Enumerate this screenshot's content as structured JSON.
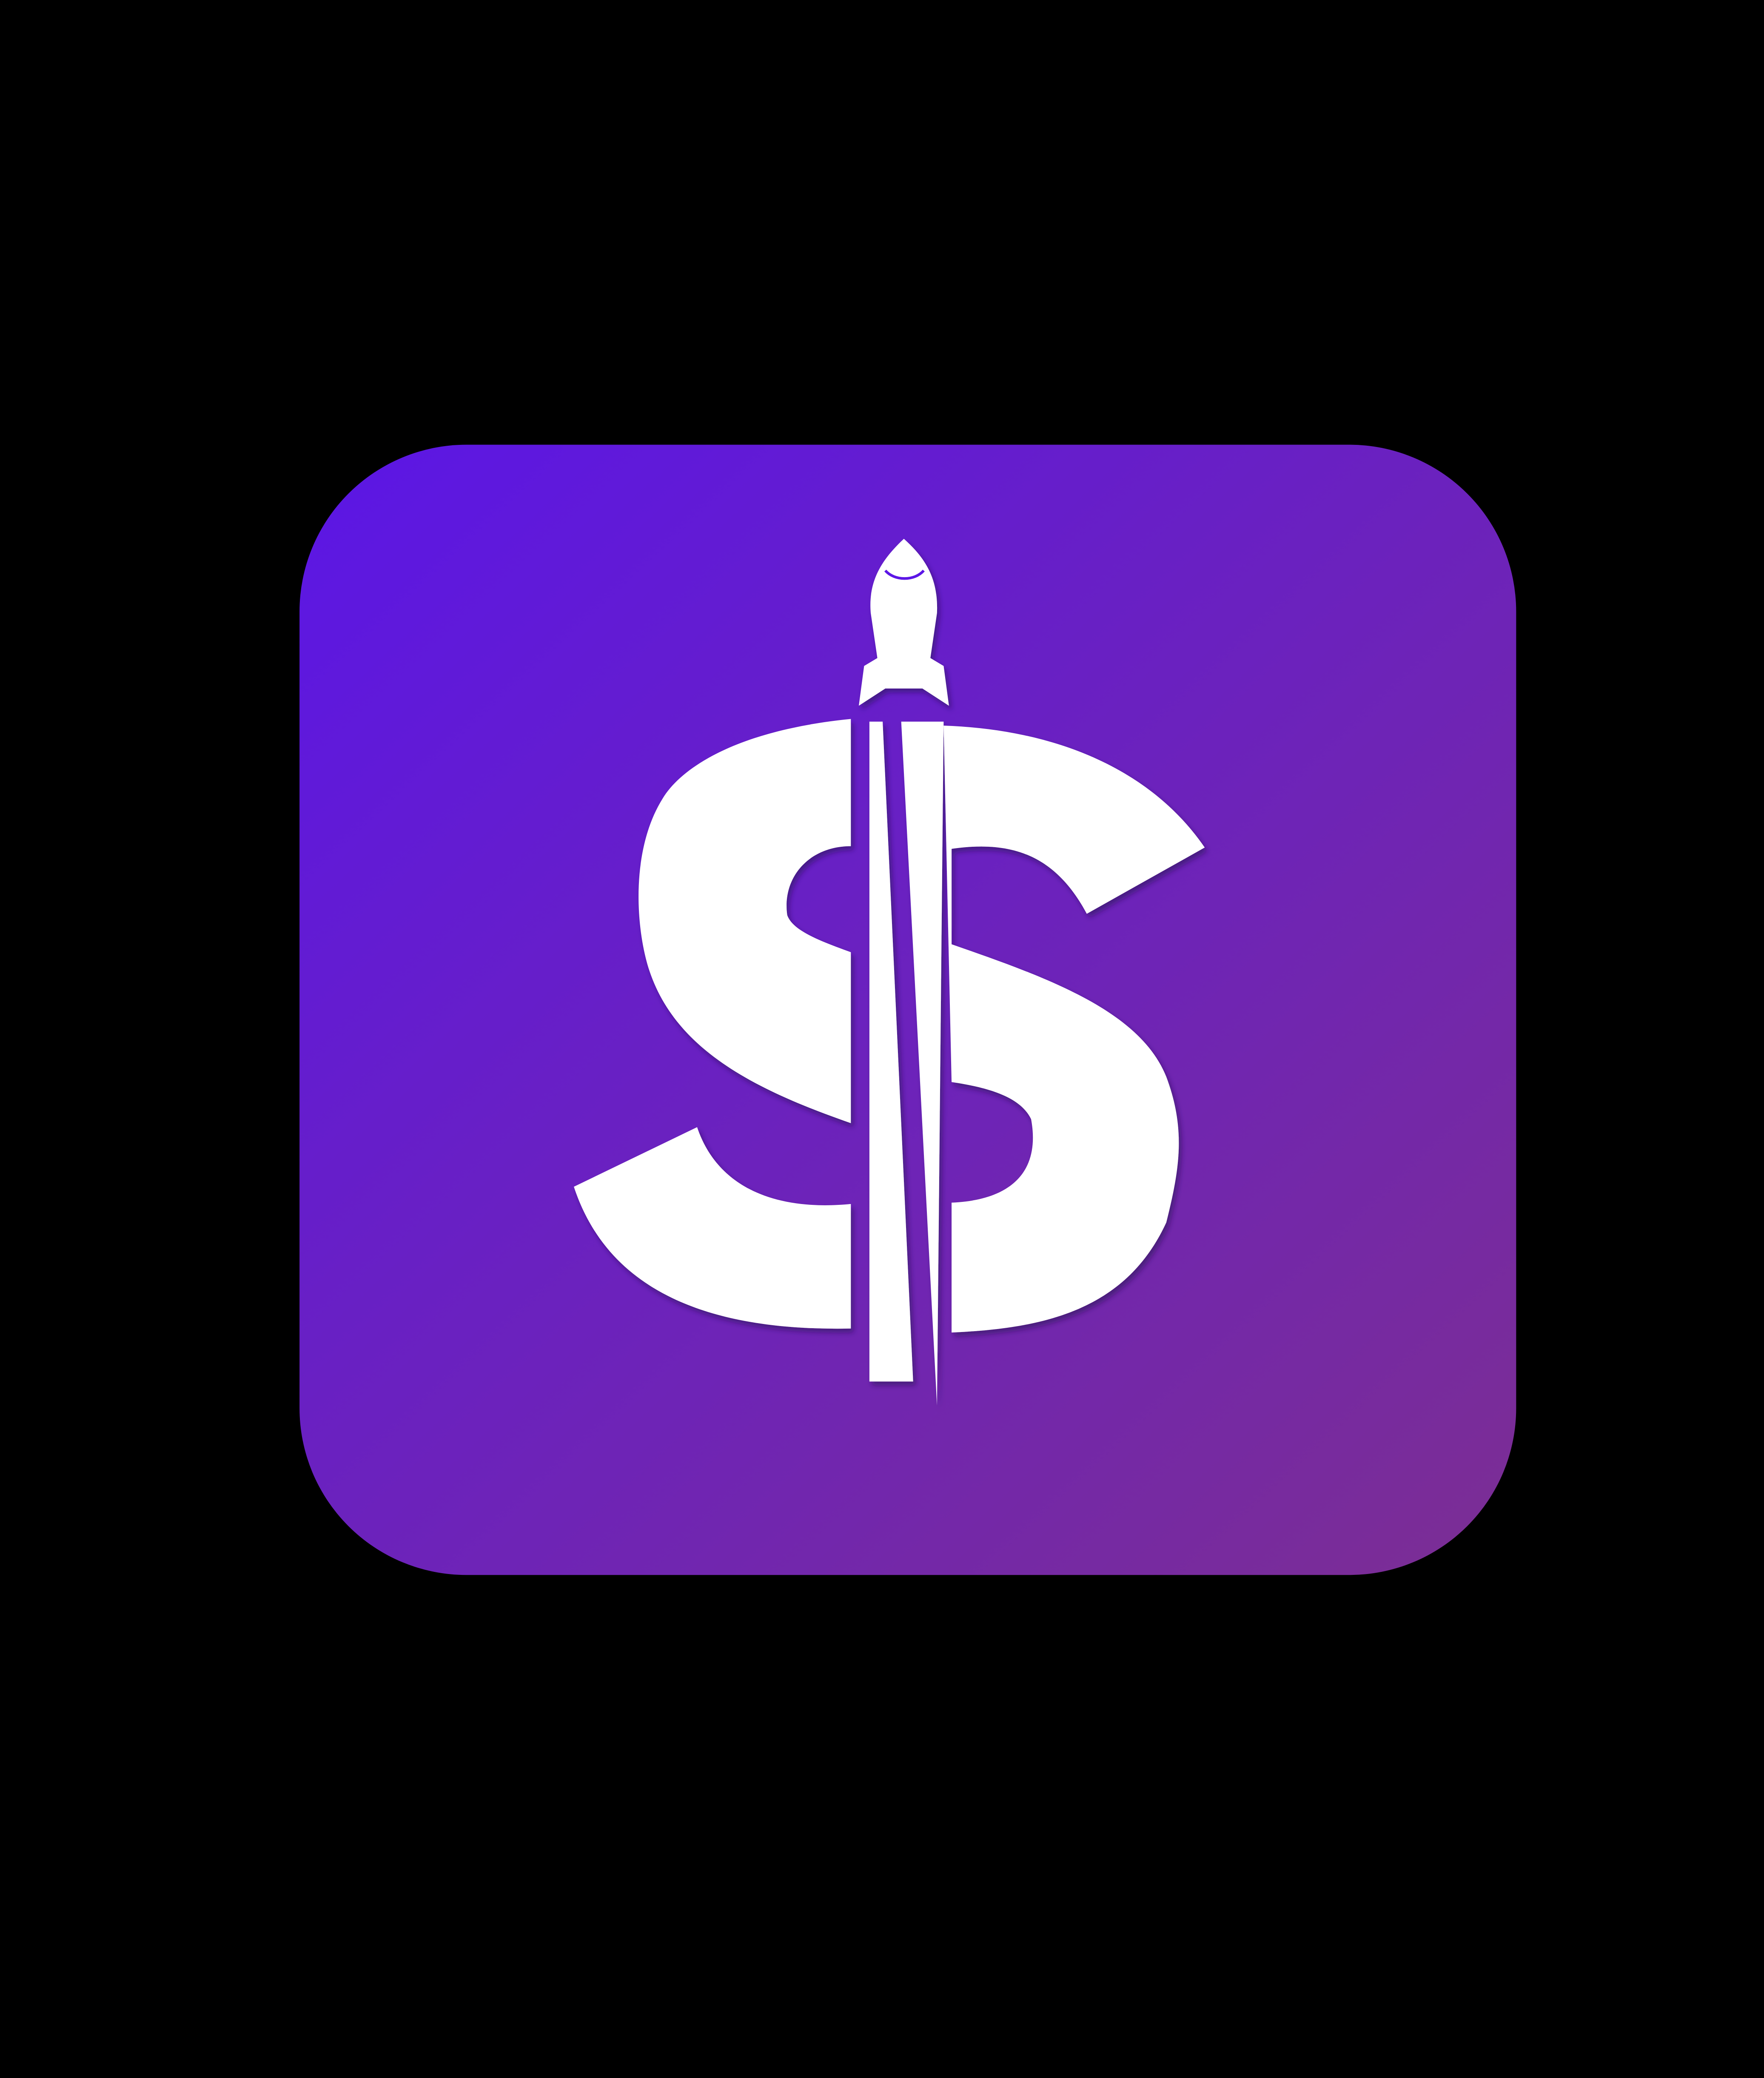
{
  "logo": {
    "name": "dollar-rocket-app-icon",
    "background_color": "#000000",
    "tile_gradient_start": "#5B16E6",
    "tile_gradient_end": "#7C2E93",
    "glyph_color": "#FFFFFF",
    "icon": "rocket-dollar-sign-icon"
  }
}
